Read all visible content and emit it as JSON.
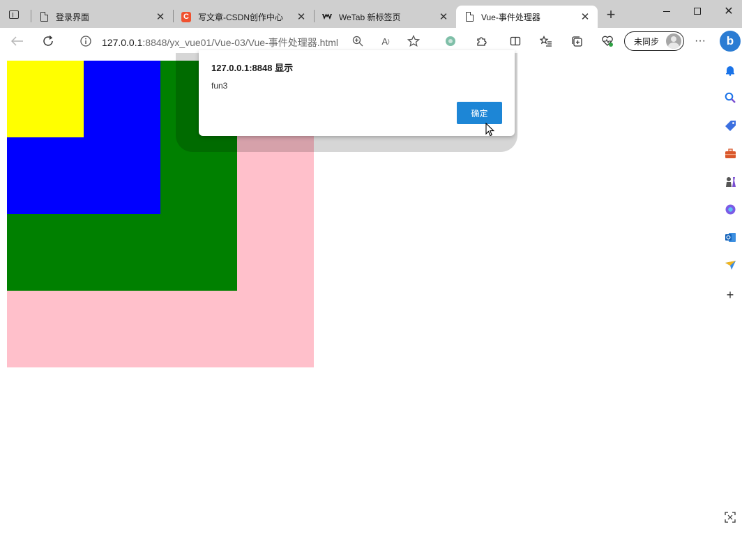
{
  "tabs": [
    {
      "title": "登录界面",
      "icon": "page-icon"
    },
    {
      "title": "写文章-CSDN创作中心",
      "icon": "csdn-icon",
      "icon_text": "C"
    },
    {
      "title": "WeTab 新标签页",
      "icon": "wetab-icon"
    },
    {
      "title": "Vue-事件处理器",
      "icon": "page-icon",
      "active": true
    }
  ],
  "address_bar": {
    "url_host": "127.0.0.1",
    "url_rest": ":8848/yx_vue01/Vue-03/Vue-事件处理器.html"
  },
  "profile": {
    "sync_label": "未同步"
  },
  "alert": {
    "title": "127.0.0.1:8848 显示",
    "message": "fun3",
    "ok_label": "确定"
  },
  "colors": {
    "outer_box": "#ffc0cb",
    "second_box": "#008000",
    "third_box": "#0000ff",
    "inner_box": "#ffff00",
    "ok_button": "#1d86d6"
  }
}
